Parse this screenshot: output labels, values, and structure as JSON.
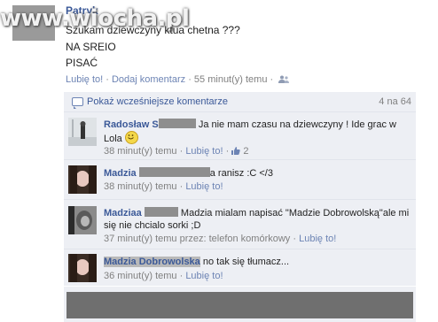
{
  "watermark": "www.wiocha.pl",
  "post": {
    "author": "Patryk",
    "lines": [
      "Szukam dziewczyny ktua chetna ???",
      "NA SREIO",
      "PISAĆ"
    ],
    "like_label": "Lubię to!",
    "sep": " · ",
    "comment_label": "Dodaj komentarz",
    "time": "55 minut(y) temu"
  },
  "comments_header": {
    "show_previous_label": "Pokaż wcześniejsze komentarze",
    "count": "4 na 64"
  },
  "comments": [
    {
      "name": "Radosław S",
      "text": "Ja nie mam czasu na dziewczyny ! Ide grac w Lola",
      "time": "38 minut(y) temu",
      "like_label": "Lubię to!",
      "likes": "2"
    },
    {
      "name": "Madzia",
      "text": "a ranisz :C </3",
      "time": "38 minut(y) temu",
      "like_label": "Lubię to!"
    },
    {
      "name": "Madziaa",
      "text": "Madzia mialam napisać \"Madzie Dobrowolską\"ale mi się nie chcialo sorki ;D",
      "time": "37 minut(y) temu przez: telefon komórkowy",
      "like_label": "Lubię to!"
    },
    {
      "name": "Madzia Dobrowolska",
      "text": "no tak się tłumacz...",
      "time": "36 minut(y) temu",
      "like_label": "Lubię to!"
    }
  ],
  "colors": {
    "link": "#3b5998",
    "comment_bg": "#edeff4",
    "meta_text": "#808080"
  }
}
